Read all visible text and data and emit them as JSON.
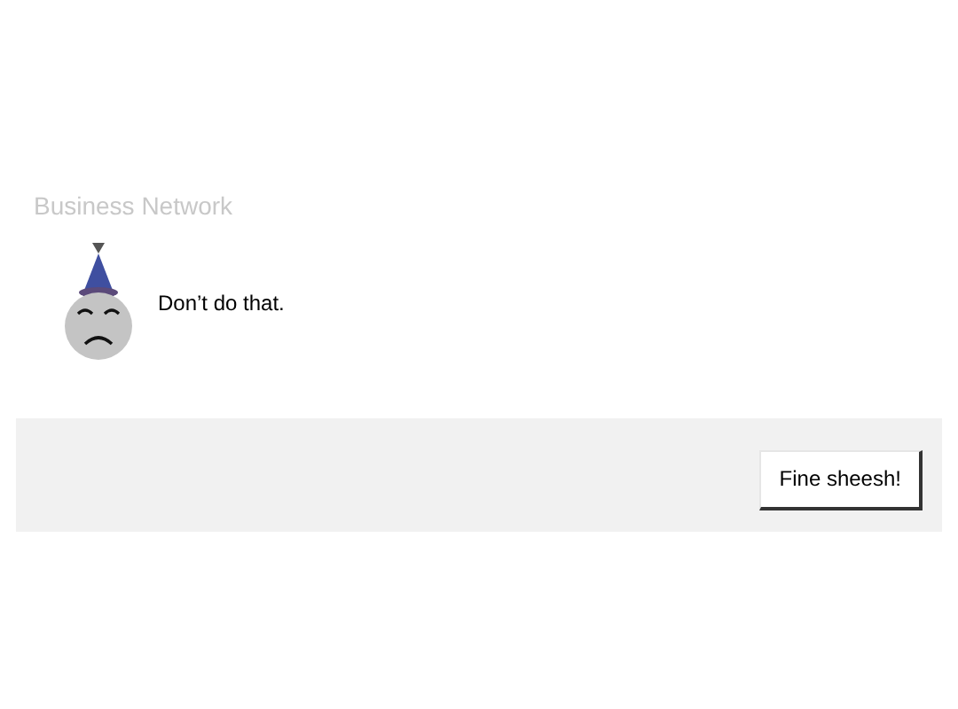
{
  "dialog": {
    "title": "Business Network",
    "message": "Don’t do that.",
    "buttons": [
      {
        "label": "Fine sheesh!"
      }
    ]
  }
}
